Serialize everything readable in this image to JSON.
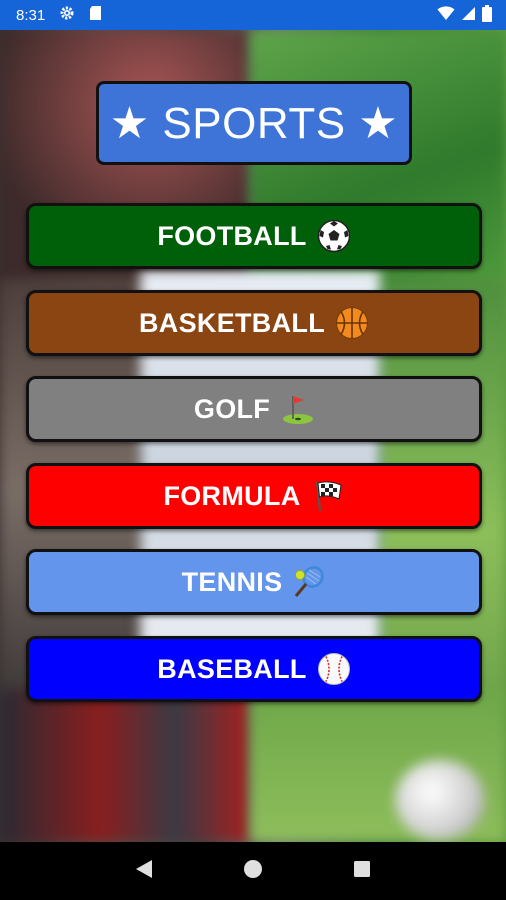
{
  "status_bar": {
    "time": "8:31",
    "icons": [
      "gear-icon",
      "sd-card-icon",
      "wifi-icon",
      "signal-icon",
      "battery-icon"
    ]
  },
  "title": "★ SPORTS ★",
  "sports": [
    {
      "label": "FOOTBALL",
      "icon": "soccer-ball-icon",
      "color": "#00600a"
    },
    {
      "label": "BASKETBALL",
      "icon": "basketball-icon",
      "color": "#8b4513"
    },
    {
      "label": "GOLF",
      "icon": "golf-flag-icon",
      "color": "#808080"
    },
    {
      "label": "FORMULA",
      "icon": "checkered-flag-icon",
      "color": "#ff0000"
    },
    {
      "label": "TENNIS",
      "icon": "tennis-racket-icon",
      "color": "#6495ed"
    },
    {
      "label": "BASEBALL",
      "icon": "baseball-icon",
      "color": "#0000ff"
    }
  ],
  "nav_bar": {
    "icons": [
      "back-icon",
      "home-icon",
      "recents-icon"
    ]
  }
}
